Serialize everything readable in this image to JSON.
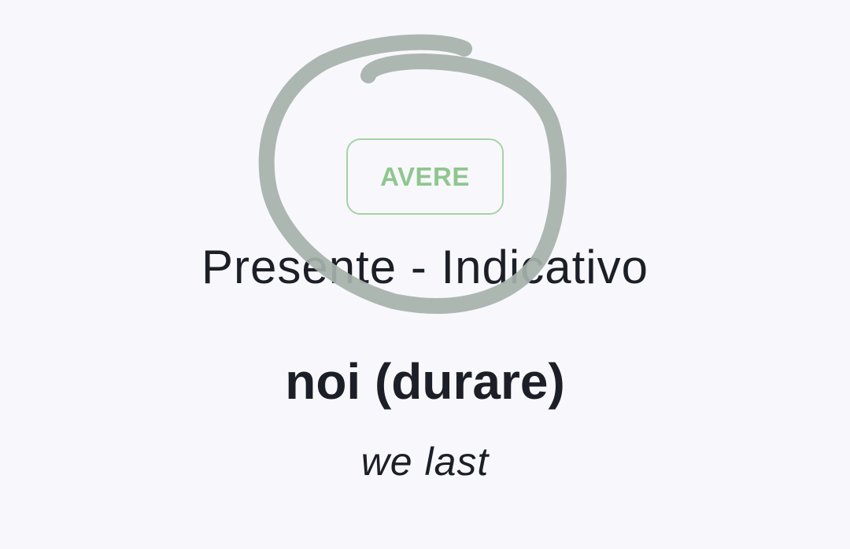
{
  "card": {
    "auxiliary_label": "AVERE",
    "tense": "Presente - Indicativo",
    "prompt": "noi (durare)",
    "translation": "we last"
  },
  "colors": {
    "background": "#f8f8fc",
    "accent_green": "#8fc68f",
    "text_dark": "#1c1f27",
    "annotation_stroke": "#a6b1ab"
  }
}
